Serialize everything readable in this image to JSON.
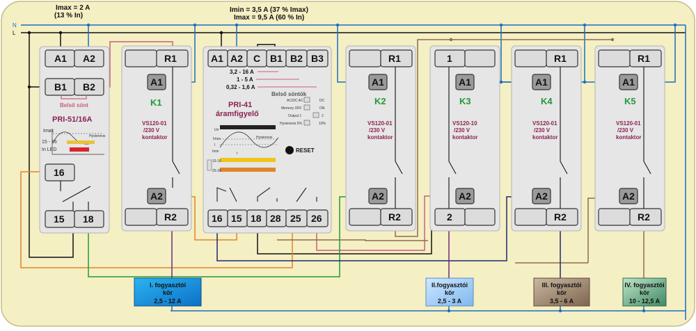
{
  "rails": {
    "n": "N",
    "l": "L"
  },
  "top_notes": {
    "left_1": "Imax = 2 A",
    "left_2": "(13 % In)",
    "mid_1": "Imin = 3,5 A (37 % Imax)",
    "mid_2": "Imax = 9,5 A (60 % In)"
  },
  "pri51": {
    "t_a1": "A1",
    "t_a2": "A2",
    "t_b1": "B1",
    "t_b2": "B2",
    "shunt": "Belső sönt",
    "name": "PRI-51/16A",
    "g_imax": "Imax",
    "g_hyst": "Hysteresis",
    "g_range": "15 - 16",
    "g_led": "In LED",
    "t_16": "16",
    "t_15": "15",
    "t_18": "18"
  },
  "pri41": {
    "t_a1": "A1",
    "t_a2": "A2",
    "t_c": "C",
    "t_b1": "B1",
    "t_b2": "B2",
    "t_b3": "B3",
    "range1": "3,2 - 16 A",
    "range2": "1 - 5 A",
    "range3": "0,32 - 1,6 A",
    "shunts": "Belső söntök",
    "name1": "PRI-41",
    "name2": "áramfigyelő",
    "sw_acdc": "AC/DC  AC",
    "sw_dc": "DC",
    "sw_mem": "Memory OFF",
    "sw_on": "ON",
    "sw_out": "Output 1",
    "sw_2": "2",
    "sw_hyst": "Hysteresis 5%",
    "sw_10": "10%",
    "g_un": "Un",
    "g_imax": "Imax",
    "g_i": "I",
    "g_imin": "Imin",
    "g_hyst": "Hysteresis",
    "g_t": "t",
    "g_1516": "15-16",
    "g_1518": "15-18",
    "g_2526": "25-26",
    "g_2528": "25-28",
    "reset": "RESET",
    "t_16": "16",
    "t_15": "15",
    "t_18": "18",
    "t_28": "28",
    "t_25": "25",
    "t_26": "26"
  },
  "k1": {
    "r1": "R1",
    "a1": "A1",
    "name": "K1",
    "model": "VS120-01",
    "voltage": "/230 V",
    "type": "kontaktor",
    "a2": "A2",
    "r2": "R2"
  },
  "k2": {
    "r1": "R1",
    "a1": "A1",
    "name": "K2",
    "model": "VS120-01",
    "voltage": "/230 V",
    "type": "kontaktor",
    "a2": "A2",
    "r2": "R2"
  },
  "k3": {
    "r1": "1",
    "a1": "A1",
    "name": "K3",
    "model": "VS120-10",
    "voltage": "/230 V",
    "type": "kontaktor",
    "a2": "A2",
    "r2": "2"
  },
  "k4": {
    "r1": "R1",
    "a1": "A1",
    "name": "K4",
    "model": "VS120-01",
    "voltage": "/230 V",
    "type": "kontaktor",
    "a2": "A2",
    "r2": "R2"
  },
  "k5": {
    "r1": "R1",
    "a1": "A1",
    "name": "K5",
    "model": "VS120-01",
    "voltage": "/230 V",
    "type": "kontaktor",
    "a2": "A2",
    "r2": "R2"
  },
  "loads": [
    {
      "l1": "I. fogyasztói",
      "l2": "kör",
      "l3": "2,5 - 12 A"
    },
    {
      "l1": "II.fogyasztói",
      "l2": "kör",
      "l3": "2,5 - 3 A"
    },
    {
      "l1": "III. fogyasztói",
      "l2": "kör",
      "l3": "3,5 - 6 A"
    },
    {
      "l1": "IV. fogyasztói",
      "l2": "kör",
      "l3": "10 - 12,5 A"
    }
  ],
  "colors": {
    "background": "#f5efc4",
    "wire_blue": "#1a6fc0",
    "wire_orange": "#e0842a",
    "wire_green": "#1f9a3a",
    "wire_pink": "#c8607a",
    "wire_brown": "#8b6d4e",
    "wire_navy": "#1e2870",
    "wire_purple": "#6b2c7a",
    "label_green": "#1f9a3a",
    "label_maroon": "#8b2252"
  }
}
